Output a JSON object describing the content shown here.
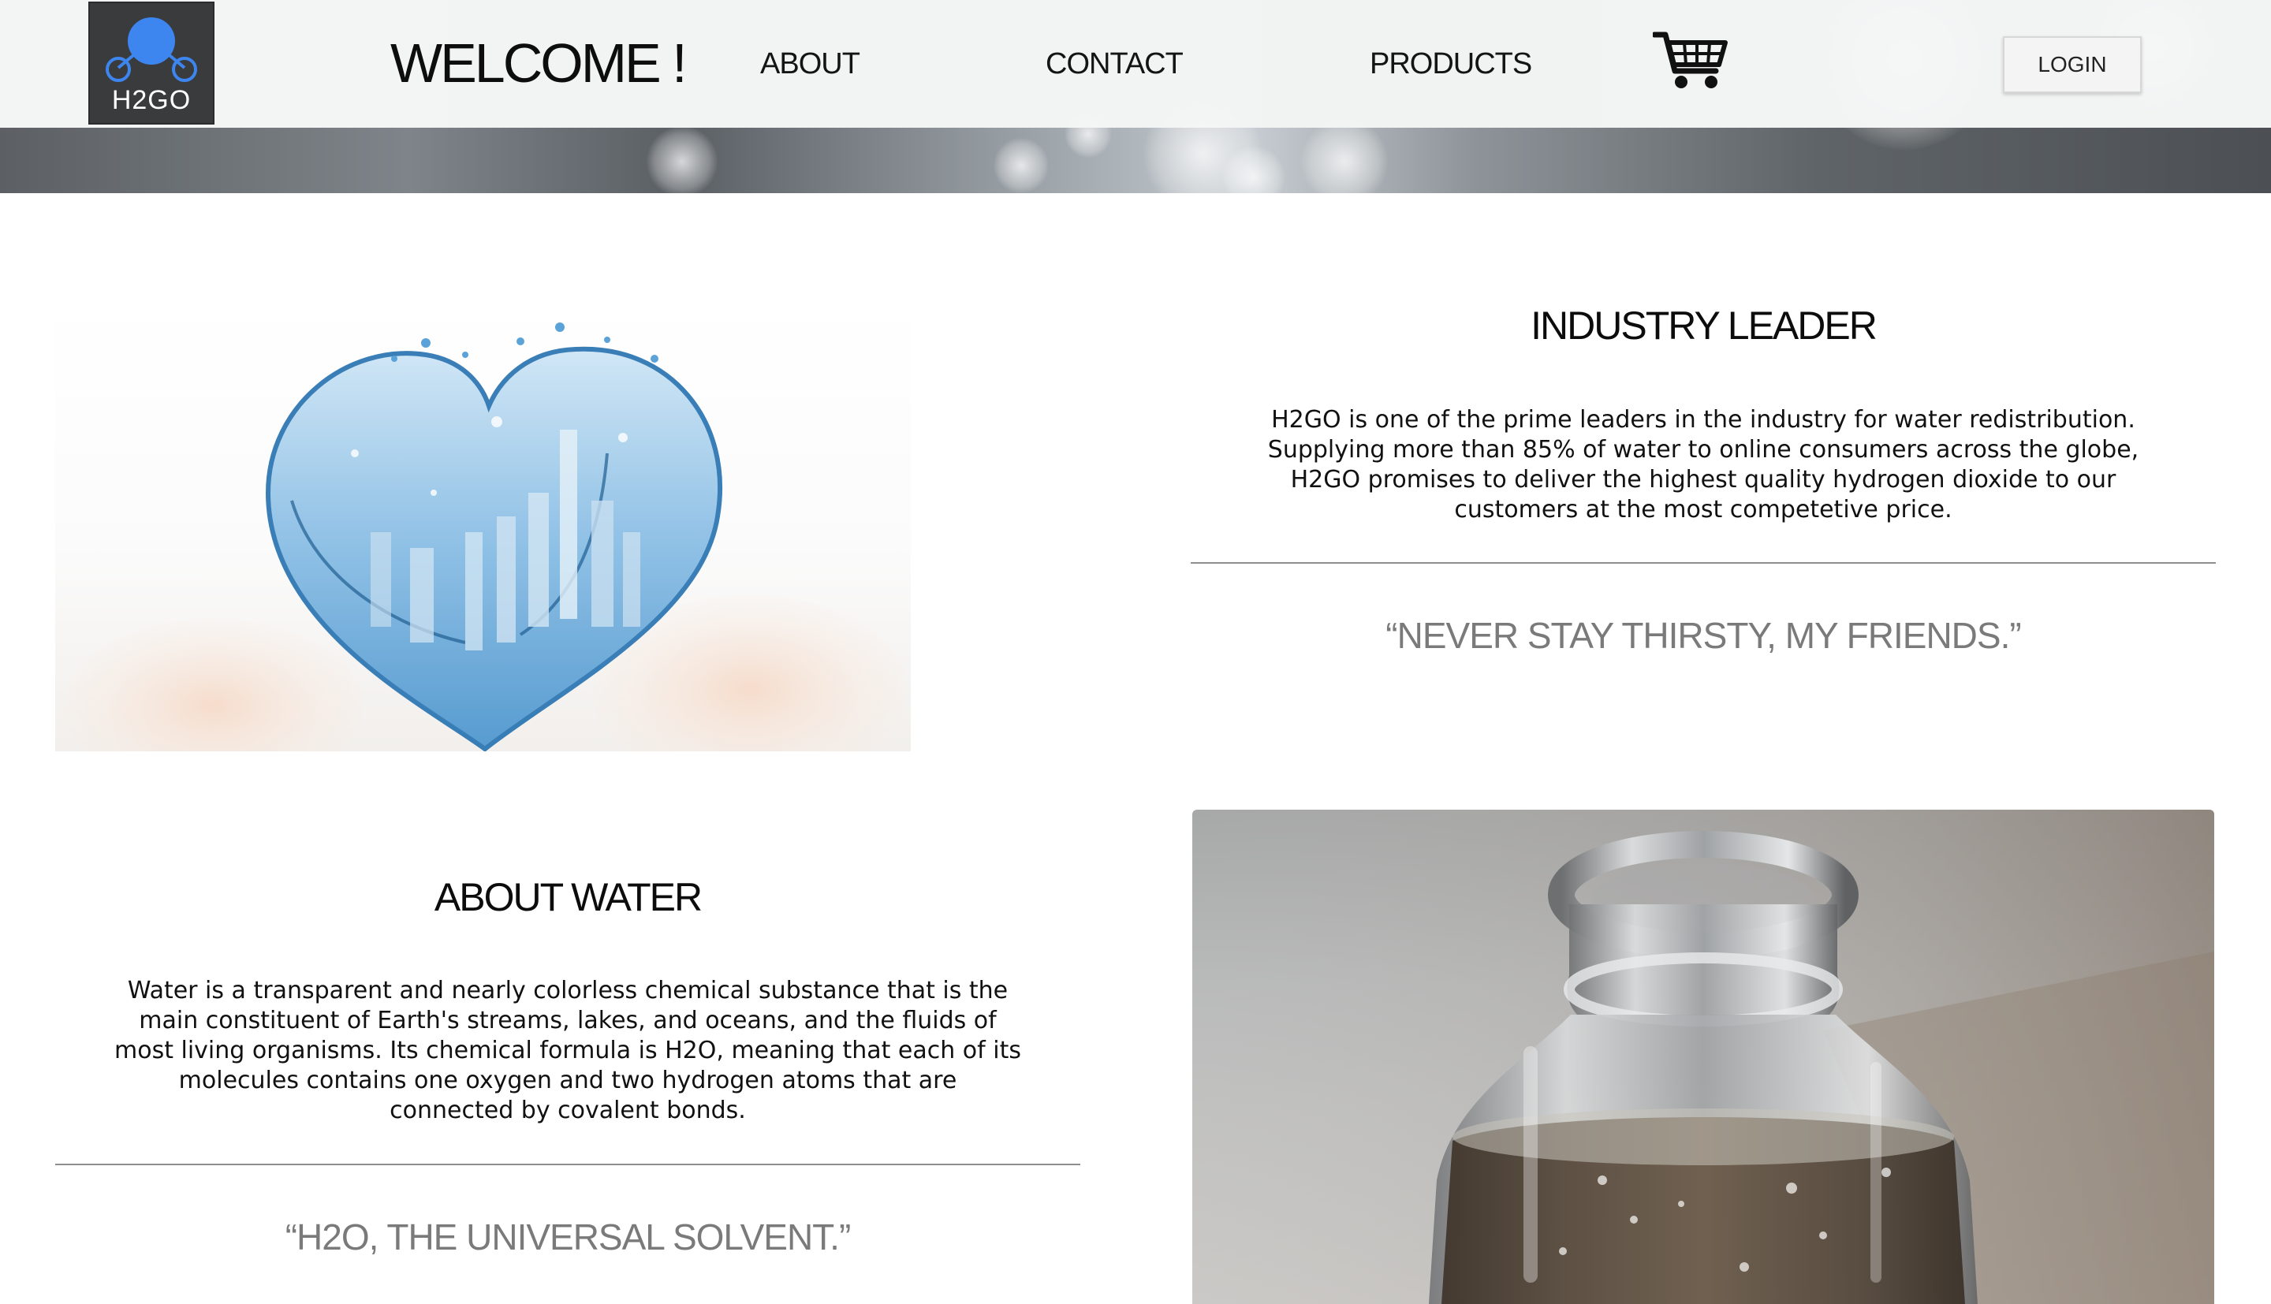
{
  "header": {
    "logo_text": "H2GO",
    "welcome": "WELCOME !",
    "nav": [
      {
        "label": "ABOUT"
      },
      {
        "label": "CONTACT"
      },
      {
        "label": "PRODUCTS"
      }
    ],
    "cart_icon": "shopping-cart-icon",
    "login_label": "LOGIN"
  },
  "industry": {
    "title": "INDUSTRY LEADER",
    "lines": [
      "H2GO is one of the prime leaders in the industry for water redistribution.",
      "Supplying more than 85% of water to online consumers across the globe,",
      "H2GO promises to deliver the highest quality hydrogen dioxide to our",
      "customers at the most competetive price."
    ],
    "quote": "“NEVER STAY THIRSTY, MY FRIENDS.”"
  },
  "about": {
    "title": "ABOUT WATER",
    "lines": [
      "Water is a transparent and nearly colorless chemical substance that is the",
      "main constituent of Earth's streams, lakes, and oceans, and the fluids of",
      "most living organisms. Its chemical formula is H2O, meaning that each of its",
      "molecules contains one oxygen and two hydrogen atoms that are",
      "connected by covalent bonds."
    ],
    "quote": "“H2O, THE UNIVERSAL SOLVENT.”"
  },
  "colors": {
    "logo_bg": "#3a3b3d",
    "logo_dot": "#3d86f0",
    "quote_gray": "#7a7a7a"
  }
}
